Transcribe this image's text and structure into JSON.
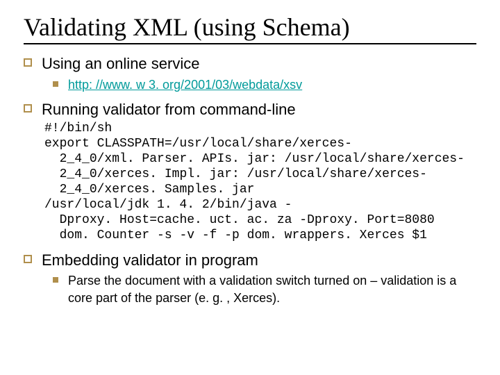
{
  "title": "Validating XML (using Schema)",
  "items": [
    {
      "text": "Using an online service",
      "sub": [
        {
          "link": "http: //www. w 3. org/2001/03/webdata/xsv"
        }
      ]
    },
    {
      "text": "Running validator from command-line",
      "code": "#!/bin/sh\nexport CLASSPATH=/usr/local/share/xerces-\n  2_4_0/xml. Parser. APIs. jar: /usr/local/share/xerces-\n  2_4_0/xerces. Impl. jar: /usr/local/share/xerces-\n  2_4_0/xerces. Samples. jar\n/usr/local/jdk 1. 4. 2/bin/java -\n  Dproxy. Host=cache. uct. ac. za -Dproxy. Port=8080\n  dom. Counter -s -v -f -p dom. wrappers. Xerces $1"
    },
    {
      "text": "Embedding validator in program",
      "sub": [
        {
          "text": "Parse the document with a validation switch turned on – validation is a core part of the parser (e. g. , Xerces)."
        }
      ]
    }
  ]
}
